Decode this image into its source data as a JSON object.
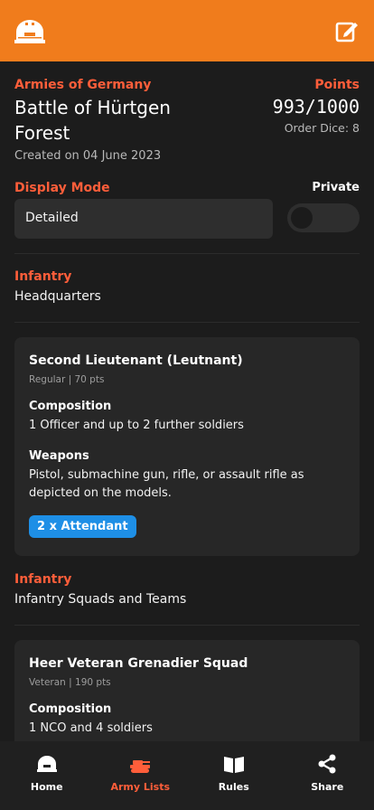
{
  "header": {
    "logo_icon": "bunker-icon",
    "edit_icon": "edit-icon"
  },
  "list": {
    "faction": "Armies of Germany",
    "title": "Battle of Hürtgen Forest",
    "created": "Created on 04 June 2023",
    "points_label": "Points",
    "points_value": "993/1000",
    "order_dice": "Order Dice: 8"
  },
  "display": {
    "label": "Display Mode",
    "value": "Detailed",
    "private_label": "Private",
    "private_on": false
  },
  "sections": [
    {
      "category": "Infantry",
      "subcategory": "Headquarters"
    },
    {
      "category": "Infantry",
      "subcategory": "Infantry Squads and Teams"
    }
  ],
  "units": [
    {
      "name": "Second Lieutenant (Leutnant)",
      "meta": "Regular | 70 pts",
      "composition_label": "Composition",
      "composition": "1 Officer and up to 2 further soldiers",
      "weapons_label": "Weapons",
      "weapons": "Pistol, submachine gun, rifle, or assault rifle as depicted on the models.",
      "badge": "2 x Attendant"
    },
    {
      "name": "Heer Veteran Grenadier Squad",
      "meta": "Veteran | 190 pts",
      "composition_label": "Composition",
      "composition": "1 NCO and 4 soldiers"
    }
  ],
  "nav": [
    {
      "label": "Home",
      "icon": "bunker-icon",
      "active": false
    },
    {
      "label": "Army Lists",
      "icon": "tank-icon",
      "active": true
    },
    {
      "label": "Rules",
      "icon": "book-icon",
      "active": false
    },
    {
      "label": "Share",
      "icon": "share-icon",
      "active": false
    }
  ],
  "colors": {
    "accent": "#f07c1c",
    "highlight": "#ff5e3a",
    "badge": "#1e8fe6",
    "background": "#1c1c1c"
  }
}
